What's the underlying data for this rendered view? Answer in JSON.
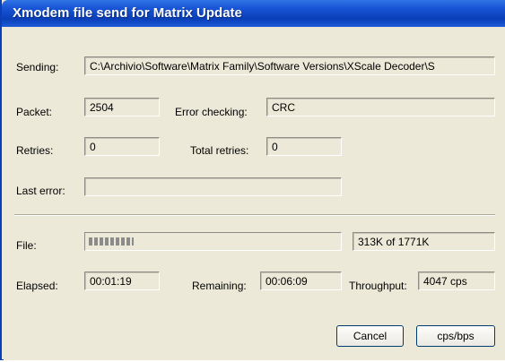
{
  "window": {
    "title": "Xmodem file send for Matrix Update"
  },
  "labels": {
    "sending": "Sending:",
    "packet": "Packet:",
    "error_checking": "Error checking:",
    "retries": "Retries:",
    "total_retries": "Total retries:",
    "last_error": "Last error:",
    "file": "File:",
    "elapsed": "Elapsed:",
    "remaining": "Remaining:",
    "throughput": "Throughput:"
  },
  "values": {
    "sending": "C:\\Archivio\\Software\\Matrix Family\\Software Versions\\XScale Decoder\\S",
    "packet": "2504",
    "error_checking": "CRC",
    "retries": "0",
    "total_retries": "0",
    "last_error": "",
    "file_progress_text": "313K of 1771K",
    "elapsed": "00:01:19",
    "remaining": "00:06:09",
    "throughput": "4047 cps"
  },
  "progress": {
    "fraction": 0.1767
  },
  "buttons": {
    "cancel": "Cancel",
    "cps_bps": "cps/bps"
  },
  "colors": {
    "titlebar": "#0a3fb8",
    "dialog_bg": "#ece9d8"
  }
}
